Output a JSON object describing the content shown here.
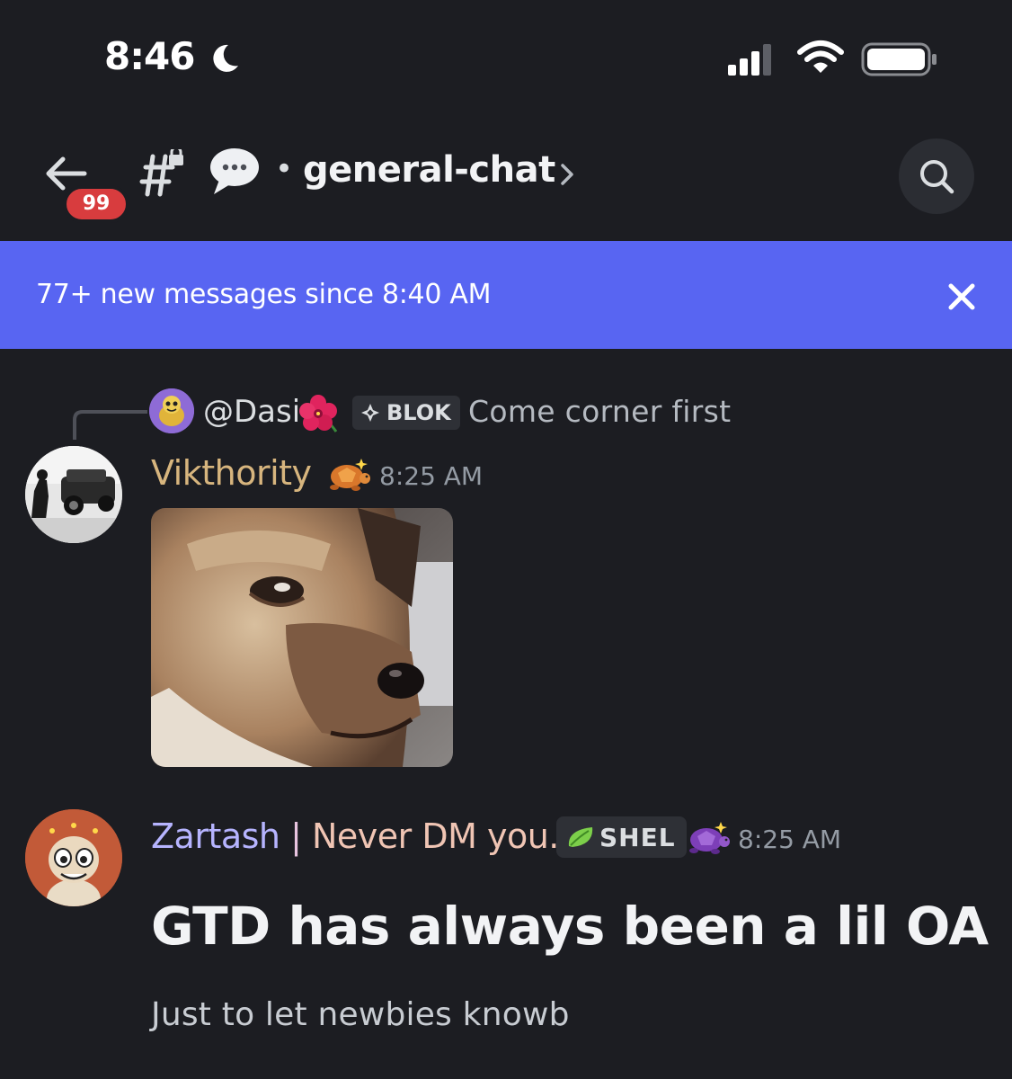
{
  "status_bar": {
    "time": "8:46",
    "icons": [
      "moon-icon",
      "signal-icon",
      "wifi-icon",
      "battery-icon"
    ]
  },
  "header": {
    "back_icon": "back-arrow-icon",
    "unread_count": "99",
    "channel_name": "general-chat",
    "separator": "•",
    "icons": [
      "channel-hash-icon",
      "thread-bubble-icon",
      "chevron-right-icon",
      "search-icon"
    ]
  },
  "banner": {
    "text": "77+ new messages since 8:40 AM",
    "close_icon": "close-icon",
    "color": "#5865f2"
  },
  "messages": [
    {
      "reply": {
        "username": "@Dasi",
        "tag": "BLOK",
        "text": "Come corner first"
      },
      "username": "Vikthority",
      "username_color": "#d7b57e",
      "timestamp": "8:25 AM",
      "attachment": "dog-gif-image"
    },
    {
      "username_parts": [
        "Zartash",
        " | ",
        "Never DM you."
      ],
      "tag": "SHEL",
      "timestamp": "8:25 AM",
      "heading": "GTD has always been a lil OA",
      "text": "Just to let newbies knowb"
    }
  ],
  "colors": {
    "background": "#1c1d22",
    "badge": "#d83c3e",
    "accent": "#5865f2"
  }
}
